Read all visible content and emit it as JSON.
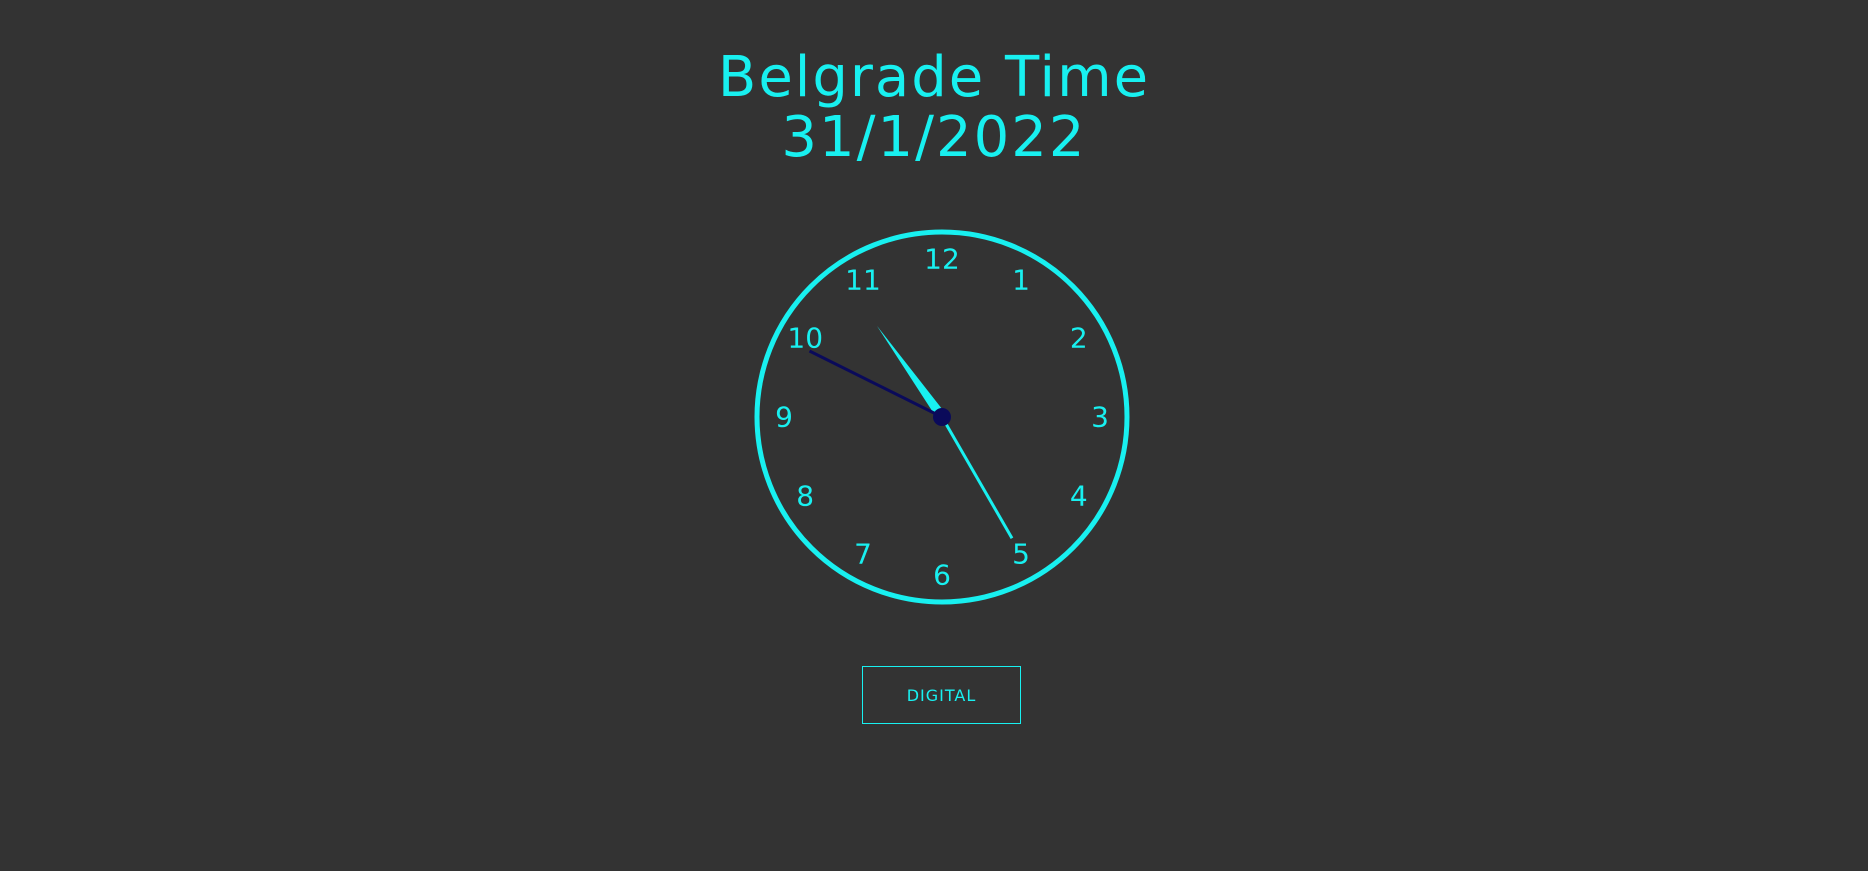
{
  "header": {
    "title": "Belgrade Time",
    "date": "31/1/2022"
  },
  "clock": {
    "numbers": [
      "12",
      "1",
      "2",
      "3",
      "4",
      "5",
      "6",
      "7",
      "8",
      "9",
      "10",
      "11"
    ],
    "time": {
      "hours": 10,
      "minutes": 49,
      "seconds": 25
    },
    "colors": {
      "face_ring": "#18f0f0",
      "numbers": "#18f0f0",
      "hour_hand": "#18f0f0",
      "minute_hand": "#0a0a5a",
      "second_hand": "#18f0f0",
      "center_pin": "#0a0a5a"
    }
  },
  "toggle_button": {
    "label": "DIGITAL"
  },
  "theme": {
    "background": "#333333",
    "accent": "#18f0f0"
  }
}
